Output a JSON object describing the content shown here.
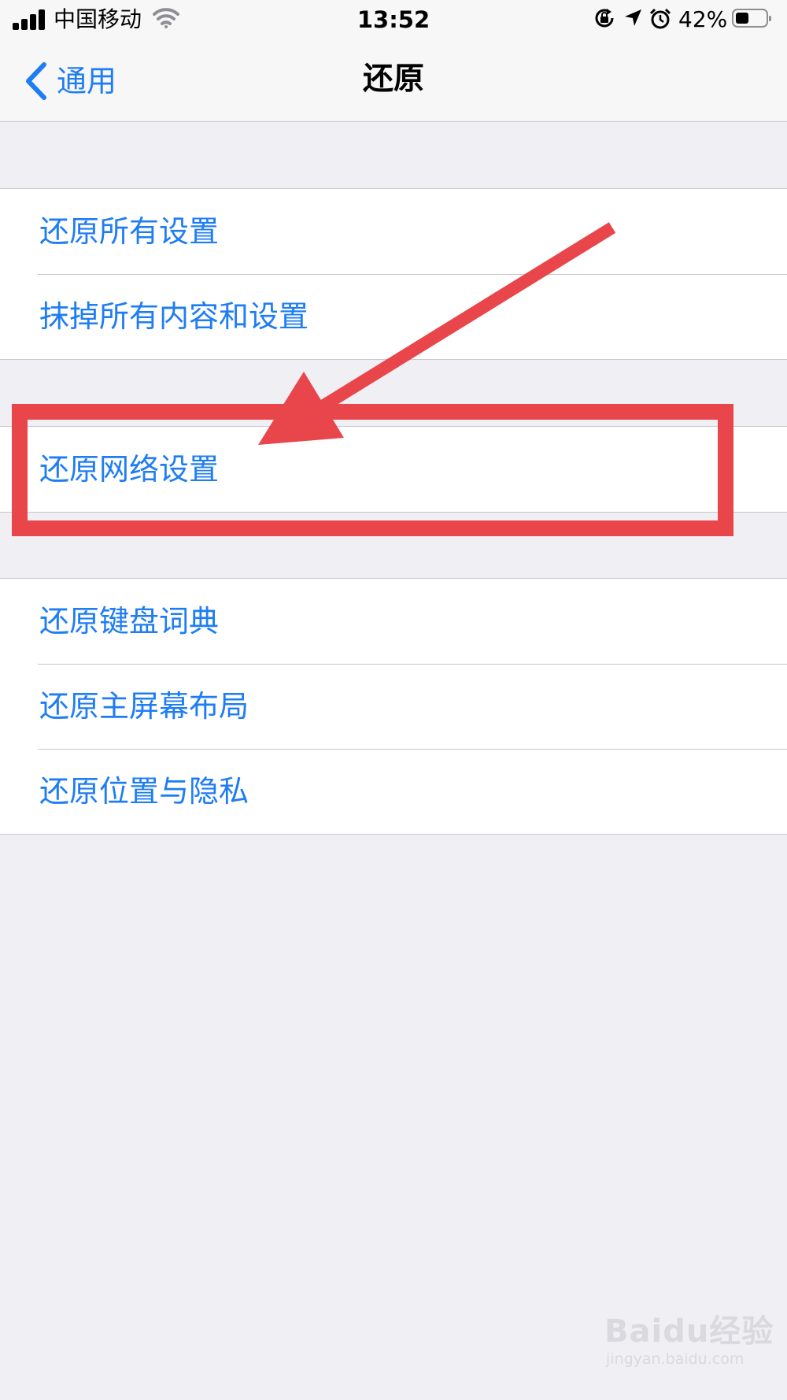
{
  "status_bar": {
    "carrier": "中国移动",
    "time": "13:52",
    "battery_percent": "42%",
    "battery_level": 0.42,
    "icons": [
      "signal-icon",
      "wifi-icon",
      "orientation-lock-icon",
      "location-icon",
      "alarm-icon",
      "battery-icon"
    ]
  },
  "nav": {
    "back_label": "通用",
    "title": "还原"
  },
  "groups": [
    {
      "items": [
        {
          "label": "还原所有设置"
        },
        {
          "label": "抹掉所有内容和设置"
        }
      ]
    },
    {
      "items": [
        {
          "label": "还原网络设置"
        }
      ]
    },
    {
      "items": [
        {
          "label": "还原键盘词典"
        },
        {
          "label": "还原主屏幕布局"
        },
        {
          "label": "还原位置与隐私"
        }
      ]
    }
  ],
  "annotation": {
    "color": "#e8464b"
  },
  "watermark": {
    "brand": "Baidu经验",
    "site": "jingyan.baidu.com"
  },
  "colors": {
    "accent": "#1f7df3",
    "background": "#efeff4"
  }
}
